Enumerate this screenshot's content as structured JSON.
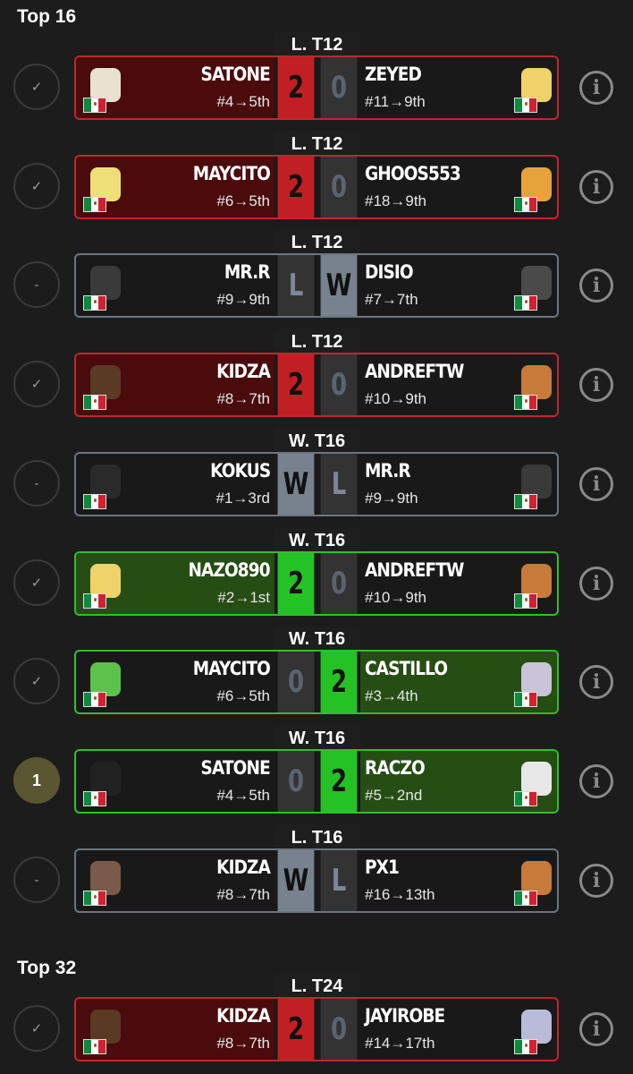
{
  "sections": [
    {
      "title": "Top 16"
    },
    {
      "title": "Top 32"
    }
  ],
  "matches": [
    {
      "round": "L. T12",
      "status": "✓",
      "left": {
        "name": "SATONE",
        "seed": "#4→5th",
        "color": "#e8e2d0",
        "scores": "2"
      },
      "right": {
        "name": "ZEYED",
        "seed": "#11→9th",
        "color": "#f0d26a",
        "scores": "0"
      },
      "style": "red-left"
    },
    {
      "round": "L. T12",
      "status": "✓",
      "left": {
        "name": "MAYCITO",
        "seed": "#6→5th",
        "color": "#f0de78",
        "scores": "2"
      },
      "right": {
        "name": "GHOOS553",
        "seed": "#18→9th",
        "color": "#e8a23c",
        "scores": "0"
      },
      "style": "red-left"
    },
    {
      "round": "L. T12",
      "status": "-",
      "left": {
        "name": "MR.R",
        "seed": "#9→9th",
        "color": "#3a3a3a",
        "scores": "L"
      },
      "right": {
        "name": "DISIO",
        "seed": "#7→7th",
        "color": "#4a4a4a",
        "scores": "W"
      },
      "style": "grey-right"
    },
    {
      "round": "L. T12",
      "status": "✓",
      "left": {
        "name": "KIDZA",
        "seed": "#8→7th",
        "color": "#5a3a22",
        "scores": "2"
      },
      "right": {
        "name": "ANDREFTW",
        "seed": "#10→9th",
        "color": "#c77a3a",
        "scores": "0"
      },
      "style": "red-left"
    },
    {
      "round": "W. T16",
      "status": "-",
      "left": {
        "name": "KOKUS",
        "seed": "#1→3rd",
        "color": "#2a2a2a",
        "scores": "W"
      },
      "right": {
        "name": "MR.R",
        "seed": "#9→9th",
        "color": "#3a3a3a",
        "scores": "L"
      },
      "style": "grey-left"
    },
    {
      "round": "W. T16",
      "status": "✓",
      "left": {
        "name": "NAZO890",
        "seed": "#2→1st",
        "color": "#f0d26a",
        "scores": "2"
      },
      "right": {
        "name": "ANDREFTW",
        "seed": "#10→9th",
        "color": "#c77a3a",
        "scores": "0"
      },
      "style": "green-left"
    },
    {
      "round": "W. T16",
      "status": "✓",
      "left": {
        "name": "MAYCITO",
        "seed": "#6→5th",
        "color": "#5cc24a",
        "scores": "0"
      },
      "right": {
        "name": "CASTILLO",
        "seed": "#3→4th",
        "color": "#c9c4d8",
        "scores": "2"
      },
      "style": "green-right"
    },
    {
      "round": "W. T16",
      "status": "1",
      "left": {
        "name": "SATONE",
        "seed": "#4→5th",
        "color": "#222222",
        "scores": "0"
      },
      "right": {
        "name": "RACZO",
        "seed": "#5→2nd",
        "color": "#e8e8e8",
        "scores": "2"
      },
      "style": "green-right"
    },
    {
      "round": "L. T16",
      "status": "-",
      "left": {
        "name": "KIDZA",
        "seed": "#8→7th",
        "color": "#7a5a48",
        "scores": "W"
      },
      "right": {
        "name": "PX1",
        "seed": "#16→13th",
        "color": "#c77a3a",
        "scores": "L"
      },
      "style": "grey-left"
    },
    {
      "round": "L. T24",
      "status": "✓",
      "left": {
        "name": "KIDZA",
        "seed": "#8→7th",
        "color": "#5a3a22",
        "scores": "2"
      },
      "right": {
        "name": "JAYIROBE",
        "seed": "#14→17th",
        "color": "#b8bcd8",
        "scores": "0"
      },
      "style": "red-left"
    }
  ],
  "info_icon": "info-icon",
  "flag_icon": "mexico-flag-icon"
}
